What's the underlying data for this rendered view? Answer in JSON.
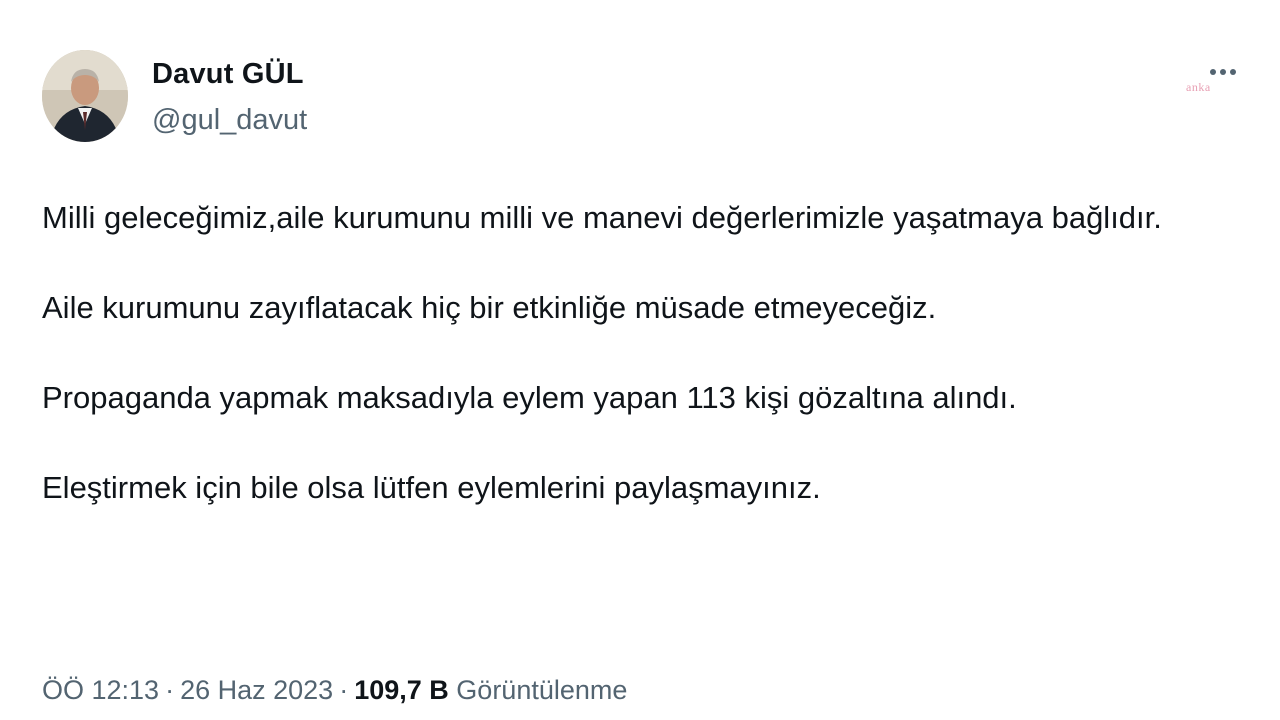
{
  "author": {
    "name": "Davut GÜL",
    "handle": "@gul_davut"
  },
  "icons": {
    "more": "more-horizontal-icon",
    "avatar": "profile-photo"
  },
  "watermark": "anka",
  "tweet": {
    "paragraphs": [
      "Milli geleceğimiz,aile kurumunu milli ve manevi değerlerimizle yaşatmaya bağlıdır.",
      "Aile kurumunu zayıflatacak hiç bir etkinliğe müsade etmeyeceğiz.",
      "Propaganda yapmak maksadıyla eylem yapan 113 kişi gözaltına alındı.",
      "Eleştirmek için bile olsa lütfen eylemlerini paylaşmayınız."
    ]
  },
  "meta": {
    "time": "ÖÖ 12:13",
    "separator": "·",
    "date": "26 Haz 2023",
    "views_count": "109,7 B",
    "views_label": "Görüntülenme"
  },
  "colors": {
    "text": "#0f1419",
    "secondary": "#536471",
    "watermark": "#e8a0b4"
  }
}
